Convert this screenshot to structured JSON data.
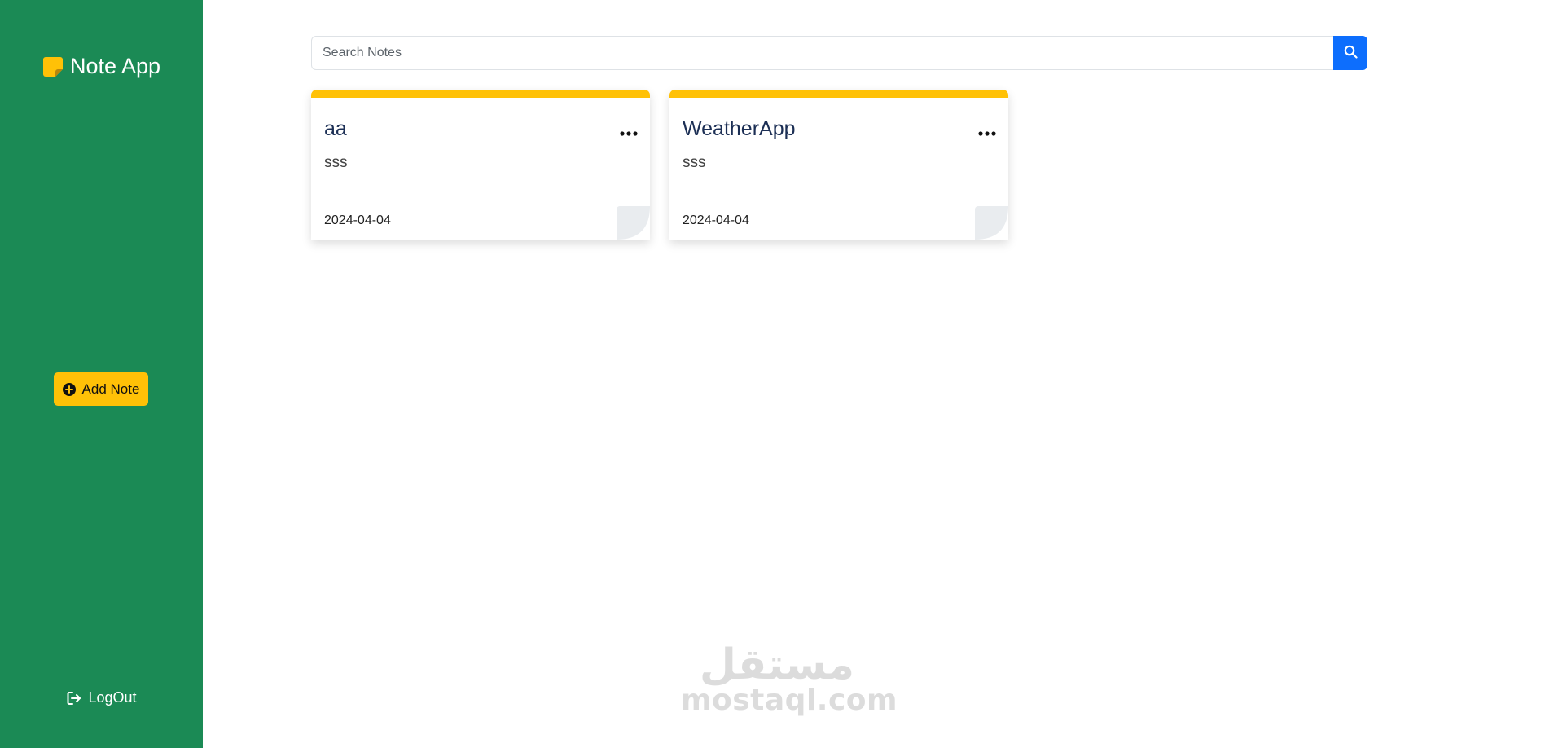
{
  "sidebar": {
    "brand_title": "Note App",
    "brand_icon": "sticky-note-icon",
    "add_note_label": "Add Note",
    "add_note_icon": "plus-circle-icon",
    "logout_label": "LogOut",
    "logout_icon": "sign-out-icon",
    "background_color": "#1b8a55",
    "accent_color": "#ffc107"
  },
  "search": {
    "placeholder": "Search Notes",
    "value": "",
    "button_icon": "search-icon",
    "button_color": "#0d6efd"
  },
  "notes": [
    {
      "title": "aa",
      "body": "sss",
      "date": "2024-04-04",
      "menu_icon": "ellipsis-icon"
    },
    {
      "title": "WeatherApp",
      "body": "sss",
      "date": "2024-04-04",
      "menu_icon": "ellipsis-icon"
    }
  ],
  "watermark": {
    "arabic_text": "مستقل",
    "latin_text": "mostaql.com"
  }
}
